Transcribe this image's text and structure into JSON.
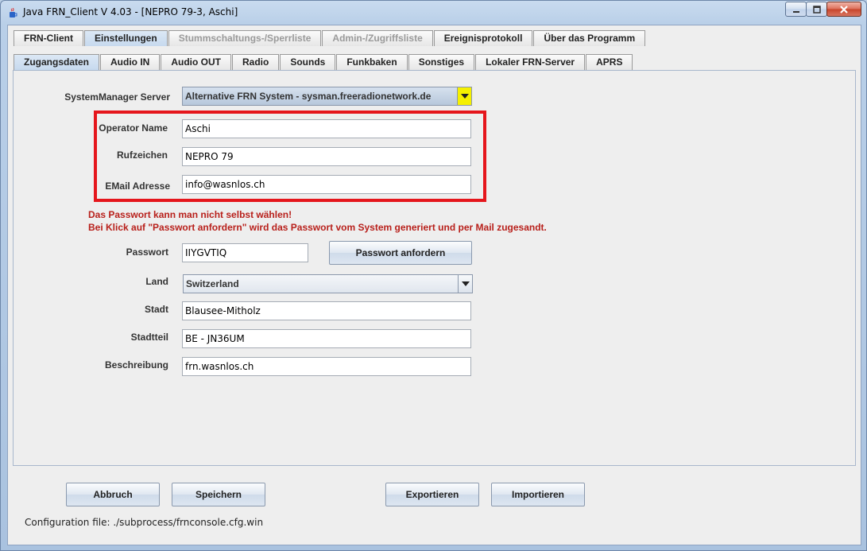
{
  "window": {
    "title": "Java FRN_Client V 4.03 - [NEPRO 79-3, Aschi]",
    "minimize_icon": "minimize-icon",
    "maximize_icon": "maximize-icon",
    "close_icon": "close-icon"
  },
  "main_tabs": [
    {
      "label": "FRN-Client",
      "state": "normal"
    },
    {
      "label": "Einstellungen",
      "state": "active"
    },
    {
      "label": "Stummschaltungs-/Sperrliste",
      "state": "disabled"
    },
    {
      "label": "Admin-/Zugriffsliste",
      "state": "disabled"
    },
    {
      "label": "Ereignisprotokoll",
      "state": "normal"
    },
    {
      "label": "Über das Programm",
      "state": "normal"
    }
  ],
  "sub_tabs": [
    {
      "label": "Zugangsdaten",
      "state": "active"
    },
    {
      "label": "Audio IN",
      "state": "normal"
    },
    {
      "label": "Audio OUT",
      "state": "normal"
    },
    {
      "label": "Radio",
      "state": "normal"
    },
    {
      "label": "Sounds",
      "state": "normal"
    },
    {
      "label": "Funkbaken",
      "state": "normal"
    },
    {
      "label": "Sonstiges",
      "state": "normal"
    },
    {
      "label": "Lokaler FRN-Server",
      "state": "normal"
    },
    {
      "label": "APRS",
      "state": "normal"
    }
  ],
  "form": {
    "sysman_label": "SystemManager Server",
    "sysman_value": "Alternative FRN System - sysman.freeradionetwork.de",
    "operator_label": "Operator Name",
    "operator_value": "Aschi",
    "callsign_label": "Rufzeichen",
    "callsign_value": "NEPRO 79",
    "email_label": "EMail Adresse",
    "email_value": "info@wasnlos.ch",
    "warning_line1": "Das Passwort kann man nicht selbst wählen!",
    "warning_line2": "Bei Klick auf \"Passwort anfordern\" wird das Passwort vom System generiert und per Mail zugesandt.",
    "password_label": "Passwort",
    "password_value": "IIYGVTIQ",
    "request_password_button": "Passwort anfordern",
    "country_label": "Land",
    "country_value": "Switzerland",
    "city_label": "Stadt",
    "city_value": "Blausee-Mitholz",
    "district_label": "Stadtteil",
    "district_value": "BE - JN36UM",
    "description_label": "Beschreibung",
    "description_value": "frn.wasnlos.ch"
  },
  "footer": {
    "cancel_button": "Abbruch",
    "save_button": "Speichern",
    "export_button": "Exportieren",
    "import_button": "Importieren",
    "config_file": "Configuration file: ./subprocess/frnconsole.cfg.win"
  },
  "colors": {
    "highlight_border": "#e5161c",
    "warning_text": "#b8201b",
    "sysman_arrow_bg": "#f5f000"
  }
}
